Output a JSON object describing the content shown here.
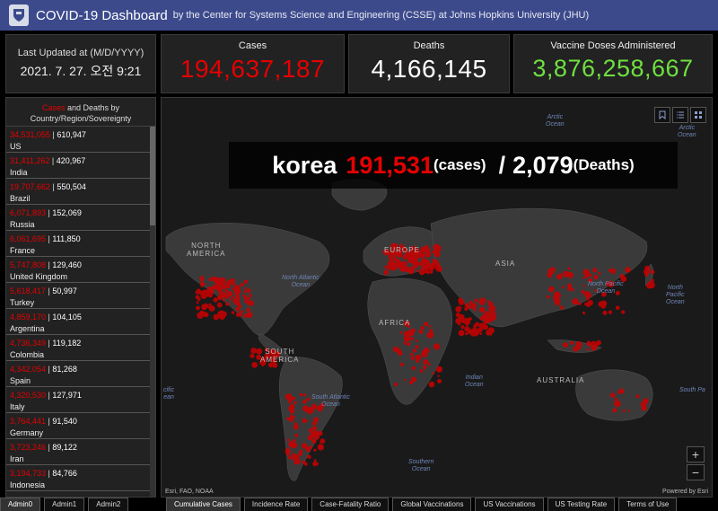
{
  "header": {
    "title": "COVID-19 Dashboard",
    "subtitle": "by the Center for Systems Science and Engineering (CSSE) at Johns Hopkins University (JHU)"
  },
  "updated": {
    "label": "Last Updated at (M/D/YYYY)",
    "value": "2021. 7. 27. 오전 9:21"
  },
  "stats": {
    "cases": {
      "label": "Cases",
      "value": "194,637,187"
    },
    "deaths": {
      "label": "Deaths",
      "value": "4,166,145"
    },
    "vaccine": {
      "label": "Vaccine Doses Administered",
      "value": "3,876,258,667"
    }
  },
  "list": {
    "head_cases": "Cases",
    "head_and": " and Deaths by",
    "head_line2": "Country/Region/Sovereignty",
    "rows": [
      {
        "cases": "34,531,055",
        "deaths": "610,947",
        "name": "US"
      },
      {
        "cases": "31,411,262",
        "deaths": "420,967",
        "name": "India"
      },
      {
        "cases": "19,707,662",
        "deaths": "550,504",
        "name": "Brazil"
      },
      {
        "cases": "6,071,893",
        "deaths": "152,069",
        "name": "Russia"
      },
      {
        "cases": "6,061,695",
        "deaths": "111,850",
        "name": "France"
      },
      {
        "cases": "5,747,808",
        "deaths": "129,460",
        "name": "United Kingdom"
      },
      {
        "cases": "5,618,417",
        "deaths": "50,997",
        "name": "Turkey"
      },
      {
        "cases": "4,859,170",
        "deaths": "104,105",
        "name": "Argentina"
      },
      {
        "cases": "4,736,349",
        "deaths": "119,182",
        "name": "Colombia"
      },
      {
        "cases": "4,342,054",
        "deaths": "81,268",
        "name": "Spain"
      },
      {
        "cases": "4,320,530",
        "deaths": "127,971",
        "name": "Italy"
      },
      {
        "cases": "3,764,441",
        "deaths": "91,540",
        "name": "Germany"
      },
      {
        "cases": "3,723,246",
        "deaths": "89,122",
        "name": "Iran"
      },
      {
        "cases": "3,194,733",
        "deaths": "84,766",
        "name": "Indonesia"
      }
    ]
  },
  "overlay": {
    "country": "korea",
    "cases": "191,531",
    "cases_unit": "(cases)",
    "slash": "/",
    "deaths": "2,079",
    "deaths_unit": "(Deaths)"
  },
  "map": {
    "labels": {
      "arctic_ocean_1": "Arctic\nOcean",
      "arctic_ocean_2": "Arctic\nOcean",
      "north_america": "NORTH\nAMERICA",
      "europe": "EUROPE",
      "asia": "ASIA",
      "africa": "AFRICA",
      "south_america": "SOUTH\nAMERICA",
      "australia": "AUSTRALIA",
      "north_atlantic": "North Atlantic\nOcean",
      "north_pacific": "North Pacific\nOcean",
      "north_pacific_2": "North\nPacific\nOcean",
      "south_atlantic": "South Atlantic\nOcean",
      "indian_ocean": "Indian\nOcean",
      "south_pacific": "South Pa",
      "pacific_left": "cific\nean",
      "southern_ocean": "Southern\nOcean"
    },
    "zoom_in": "+",
    "zoom_out": "−",
    "attribution": "Esri, FAO, NOAA",
    "powered_by": "Powered by Esri",
    "colors": {
      "dot": "#cc0000",
      "land": "#3a3a3a",
      "water": "#1a1a1a"
    }
  },
  "tabs_left": [
    "Admin0",
    "Admin1",
    "Admin2"
  ],
  "tabs_right": [
    "Cumulative Cases",
    "Incidence Rate",
    "Case-Fatality Ratio",
    "Global Vaccinations",
    "US Vaccinations",
    "US Testing Rate",
    "Terms of Use"
  ]
}
